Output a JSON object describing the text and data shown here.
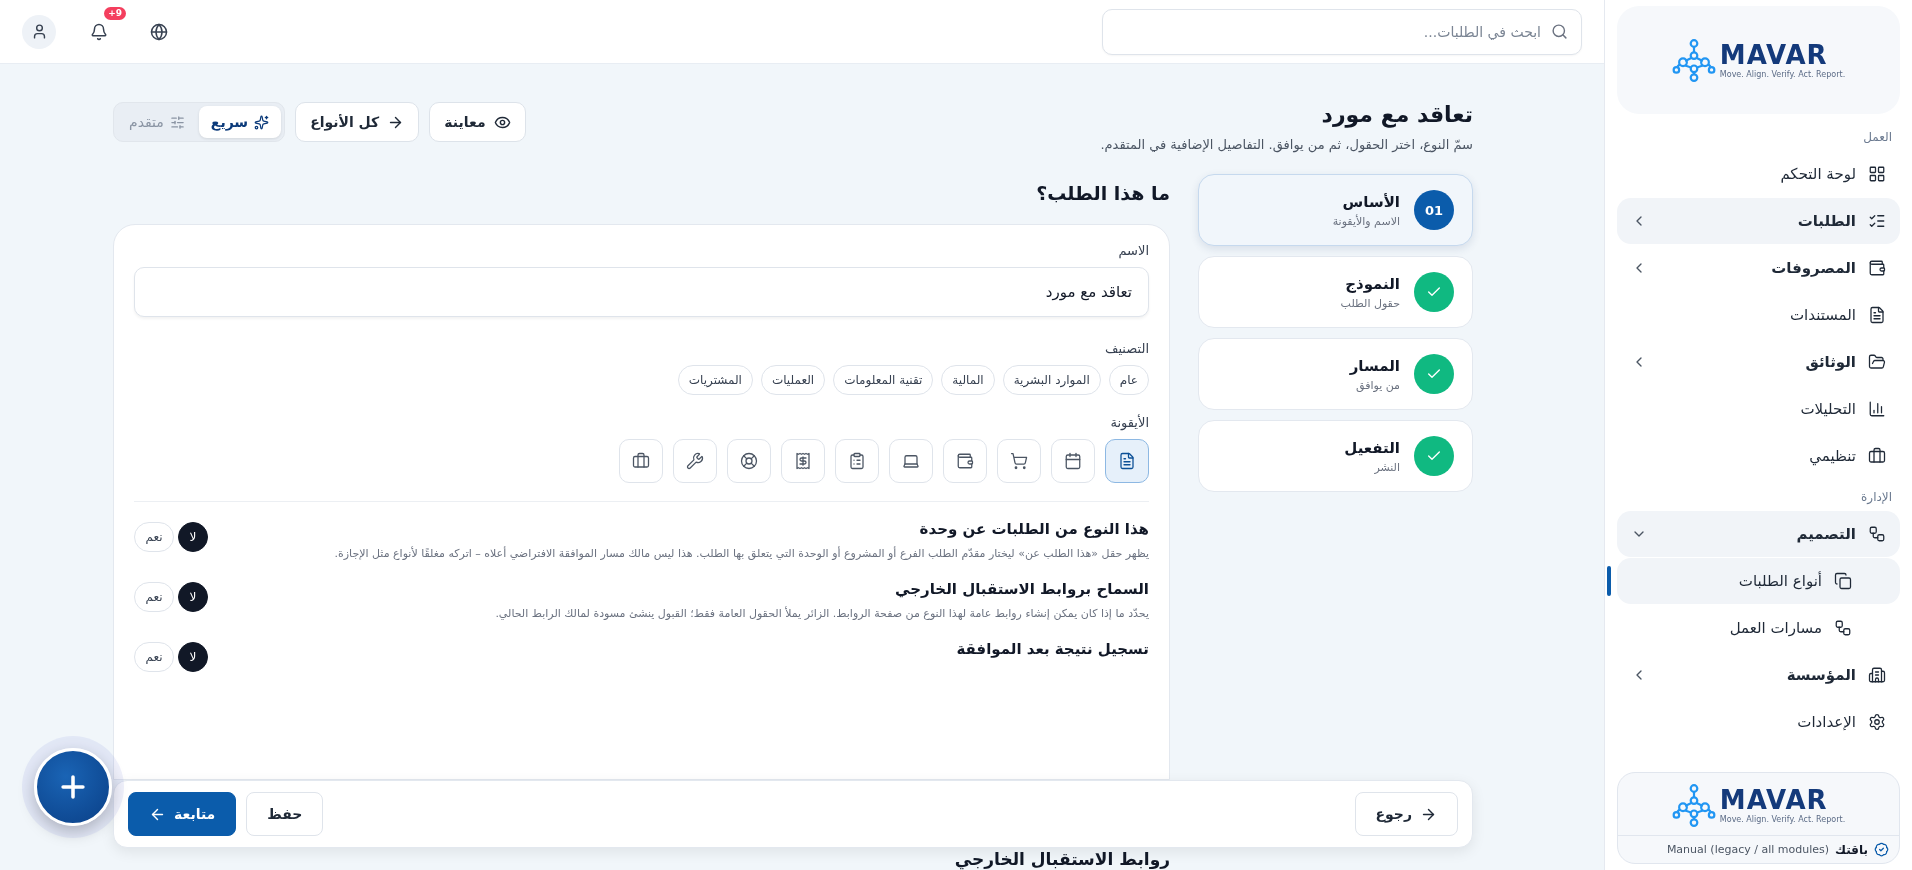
{
  "topbar": {
    "search": {
      "placeholder": "ابحث في الطلبات..."
    },
    "notifications_badge": "+9"
  },
  "header": {
    "title": "تعاقد مع مورد",
    "subtitle": "سمّ النوع، اختر الحقول، ثم من يوافق. التفاصيل الإضافية في المتقدم.",
    "actions": [
      {
        "label": "معاينة",
        "kind": "preview"
      },
      {
        "label": "كل الأنواع",
        "kind": "all"
      }
    ],
    "modes": [
      {
        "label": "سريع",
        "kind": "quick",
        "selected": true
      },
      {
        "label": "متقدم",
        "kind": "advanced",
        "selected": false
      }
    ]
  },
  "steps": [
    {
      "number": "01",
      "title": "الأساس",
      "subtitle": "الاسم والأيقونة",
      "selected": true,
      "done": false
    },
    {
      "title": "النموذج",
      "subtitle": "حقول الطلب",
      "selected": false,
      "done": true
    },
    {
      "title": "المسار",
      "subtitle": "من يوافق",
      "selected": false,
      "done": true
    },
    {
      "title": "التفعيل",
      "subtitle": "النشر",
      "selected": false,
      "done": true
    }
  ],
  "section_title": "ما هذا الطلب؟",
  "name_field": {
    "label": "الاسم",
    "value": "تعاقد مع مورد"
  },
  "category": {
    "label": "التصنيف",
    "options": [
      {
        "label": "عام",
        "selected": false
      },
      {
        "label": "الموارد البشرية",
        "selected": false
      },
      {
        "label": "المالية",
        "selected": false
      },
      {
        "label": "تقنية المعلومات",
        "selected": false
      },
      {
        "label": "العمليات",
        "selected": false
      },
      {
        "label": "المشتريات",
        "selected": false
      }
    ]
  },
  "icon_picker": {
    "label": "الأيقونة",
    "options": [
      {
        "kind": "document",
        "selected": true
      },
      {
        "kind": "calendar",
        "selected": false
      },
      {
        "kind": "cart",
        "selected": false
      },
      {
        "kind": "wallet",
        "selected": false
      },
      {
        "kind": "laptop",
        "selected": false
      },
      {
        "kind": "clipboard",
        "selected": false
      },
      {
        "kind": "receipt",
        "selected": false
      },
      {
        "kind": "lifebuoy",
        "selected": false
      },
      {
        "kind": "wrench",
        "selected": false
      },
      {
        "kind": "briefcase",
        "selected": false
      }
    ]
  },
  "settings": [
    {
      "title": "هذا النوع من الطلبات عن وحدة",
      "description": "يظهر حقل «هذا الطلب عن» ليختار مقدّم الطلب الفرع أو المشروع أو الوحدة التي يتعلق بها الطلب. هذا ليس مالك مسار الموافقة الافتراضي أعلاه – اتركه مغلقًا لأنواع مثل الإجازة.",
      "options": [
        {
          "label": "لا",
          "selected": true
        },
        {
          "label": "نعم",
          "selected": false
        }
      ]
    },
    {
      "title": "السماح بروابط الاستقبال الخارجي",
      "description": "يحدّد ما إذا كان يمكن إنشاء روابط عامة لهذا النوع من صفحة الروابط. الزائر يملأ الحقول العامة فقط؛ القبول ينشئ مسودة لمالك الرابط الحالي.",
      "options": [
        {
          "label": "لا",
          "selected": true
        },
        {
          "label": "نعم",
          "selected": false
        }
      ]
    },
    {
      "title": "تسجيل نتيجة بعد الموافقة",
      "options": [
        {
          "label": "لا",
          "selected": true
        },
        {
          "label": "نعم",
          "selected": false
        }
      ]
    }
  ],
  "footer": {
    "back": "رجوع",
    "save": "حفظ",
    "continue": "متابعة"
  },
  "next_section_title": "روابط الاستقبال الخارجي",
  "sidebar": {
    "logo": {
      "name": "MAVAR",
      "tagline": "Move. Align. Verify. Act. Report."
    },
    "sections": [
      {
        "heading": "العمل",
        "items": [
          {
            "label": "لوحة التحكم",
            "kind": "grid",
            "selected": false
          },
          {
            "label": "الطلبات",
            "kind": "checklist",
            "selected": true,
            "expanded": false
          },
          {
            "label": "المصروفات",
            "kind": "wallet",
            "selected": false,
            "expanded": false
          },
          {
            "label": "المستندات",
            "kind": "file",
            "selected": false
          },
          {
            "label": "الوثائق",
            "kind": "folder",
            "selected": false,
            "expanded": false
          },
          {
            "label": "التحليلات",
            "kind": "chart",
            "selected": false
          },
          {
            "label": "تنظيمي",
            "kind": "briefcase",
            "selected": false
          }
        ]
      },
      {
        "heading": "الإدارة",
        "items": [
          {
            "label": "التصميم",
            "kind": "workflow",
            "selected": true,
            "expanded": true,
            "children": [
              {
                "label": "أنواع الطلبات",
                "kind": "copy",
                "selected": true
              },
              {
                "label": "مسارات العمل",
                "kind": "workflow",
                "selected": false
              }
            ]
          },
          {
            "label": "المؤسسة",
            "kind": "building",
            "selected": false,
            "expanded": false
          },
          {
            "label": "الإعدادات",
            "kind": "settings",
            "selected": false
          }
        ]
      }
    ],
    "plan": {
      "logo": {
        "name": "MAVAR",
        "tagline": "Move. Align. Verify. Act. Report."
      },
      "label": "باقتك",
      "value": "Manual (legacy / all modules)"
    }
  }
}
